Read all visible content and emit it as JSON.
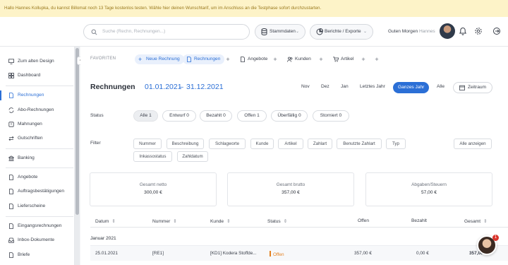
{
  "banner": {
    "text": "Hallo Hannes Kollupka, du kannst Billomat noch 13 Tage kostenlos testen. Wähle hier deinen Wunschtarif, um im Anschluss an die Testphase sofort durchzustarten."
  },
  "topbar": {
    "search_placeholder": "Suche (Rechn, Rechnungen...)",
    "stammdaten": "Stammdaten",
    "berichte": "Berichte / Exporte",
    "greeting": "Guten Morgen",
    "user_name": "Hannes"
  },
  "sidebar": {
    "items": [
      {
        "label": "Zum alten Design"
      },
      {
        "label": "Dashboard"
      },
      {
        "label": "Rechnungen"
      },
      {
        "label": "Abo-Rechnungen"
      },
      {
        "label": "Mahnungen"
      },
      {
        "label": "Gutschriften"
      },
      {
        "label": "Banking"
      },
      {
        "label": "Angebote"
      },
      {
        "label": "Auftragsbestätigungen"
      },
      {
        "label": "Lieferscheine"
      },
      {
        "label": "Eingangsrechnungen"
      },
      {
        "label": "Inbox-Dokumente"
      },
      {
        "label": "Briefe"
      }
    ]
  },
  "favorites": {
    "label": "FAVORITEN",
    "items": [
      {
        "label": "Neue Rechnung"
      },
      {
        "label": "Rechnungen"
      },
      {
        "label": "Angebote"
      },
      {
        "label": "Kunden"
      },
      {
        "label": "Artikel"
      }
    ]
  },
  "header": {
    "title": "Rechnungen",
    "date_from": "01.01.2021",
    "date_sep": "–",
    "date_to": "31.12.2021",
    "periods": [
      "Nov",
      "Dez",
      "Jan",
      "Letztes Jahr",
      "Ganzes Jahr",
      "Alle"
    ],
    "zeitraum": "Zeitraum"
  },
  "status": {
    "label": "Status",
    "chips": [
      "Alle 1",
      "Entwurf 0",
      "Bezahlt 0",
      "Offen 1",
      "Überfällig 0",
      "Storniert 0"
    ]
  },
  "filter": {
    "label": "Filter",
    "chips": [
      "Nummer",
      "Beschreibung",
      "Schlagworte",
      "Kunde",
      "Artikel",
      "Zahlart",
      "Benutzte Zahlart",
      "Typ",
      "Inkassostatus",
      "Zahldatum"
    ],
    "show_all": "Alle anzeigen"
  },
  "kpis": [
    {
      "label": "Gesamt netto",
      "value": "300,00 €"
    },
    {
      "label": "Gesamt brutto",
      "value": "357,00 €"
    },
    {
      "label": "Abgaben/Steuern",
      "value": "57,00 €"
    }
  ],
  "table": {
    "columns": [
      "Datum",
      "Nummer",
      "Kunde",
      "Status",
      "Offen",
      "Bezahlt",
      "Gesamt"
    ],
    "group": "Januar 2021",
    "rows": [
      {
        "datum": "25.01.2021",
        "nummer": "[RE1]",
        "kunde": "[KD1] Kodera Stoffde...",
        "status": "Offen",
        "offen": "357,00 €",
        "bezahlt": "0,00 €",
        "gesamt": "357,00 €"
      }
    ]
  },
  "chat": {
    "badge": "1"
  },
  "colors": {
    "accent": "#2b6fd6",
    "banner_bg": "#fdf3c8",
    "open_status": "#e38020"
  }
}
